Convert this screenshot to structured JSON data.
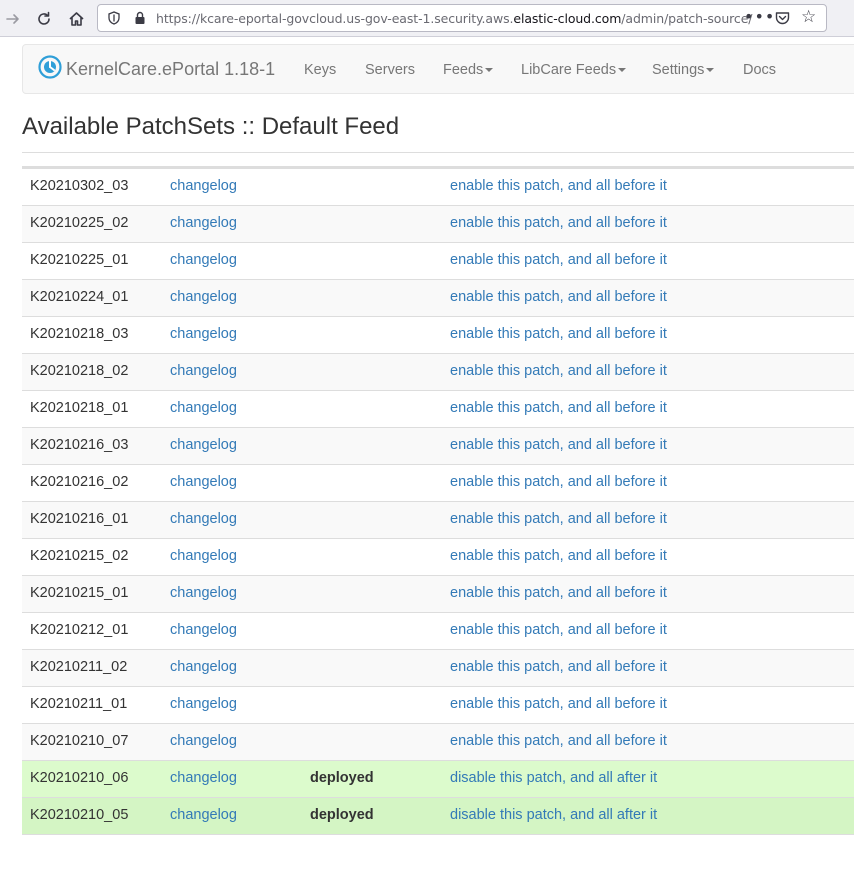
{
  "browser": {
    "url_prefix": "https://kcare-eportal-govcloud.us-gov-east-1.security.aws.",
    "url_domain": "elastic-cloud.com",
    "url_path": "/admin/patch-source/",
    "more_icon": "•••"
  },
  "navbar": {
    "brand": "KernelCare.ePortal 1.18-1",
    "links": [
      "Keys",
      "Servers",
      "Feeds",
      "LibCare Feeds",
      "Settings",
      "Docs"
    ]
  },
  "page": {
    "title": "Available PatchSets :: Default Feed"
  },
  "patches": [
    {
      "name": "K20210302_03",
      "changelog": "changelog",
      "status": "",
      "action": "enable this patch, and all before it"
    },
    {
      "name": "K20210225_02",
      "changelog": "changelog",
      "status": "",
      "action": "enable this patch, and all before it"
    },
    {
      "name": "K20210225_01",
      "changelog": "changelog",
      "status": "",
      "action": "enable this patch, and all before it"
    },
    {
      "name": "K20210224_01",
      "changelog": "changelog",
      "status": "",
      "action": "enable this patch, and all before it"
    },
    {
      "name": "K20210218_03",
      "changelog": "changelog",
      "status": "",
      "action": "enable this patch, and all before it"
    },
    {
      "name": "K20210218_02",
      "changelog": "changelog",
      "status": "",
      "action": "enable this patch, and all before it"
    },
    {
      "name": "K20210218_01",
      "changelog": "changelog",
      "status": "",
      "action": "enable this patch, and all before it"
    },
    {
      "name": "K20210216_03",
      "changelog": "changelog",
      "status": "",
      "action": "enable this patch, and all before it"
    },
    {
      "name": "K20210216_02",
      "changelog": "changelog",
      "status": "",
      "action": "enable this patch, and all before it"
    },
    {
      "name": "K20210216_01",
      "changelog": "changelog",
      "status": "",
      "action": "enable this patch, and all before it"
    },
    {
      "name": "K20210215_02",
      "changelog": "changelog",
      "status": "",
      "action": "enable this patch, and all before it"
    },
    {
      "name": "K20210215_01",
      "changelog": "changelog",
      "status": "",
      "action": "enable this patch, and all before it"
    },
    {
      "name": "K20210212_01",
      "changelog": "changelog",
      "status": "",
      "action": "enable this patch, and all before it"
    },
    {
      "name": "K20210211_02",
      "changelog": "changelog",
      "status": "",
      "action": "enable this patch, and all before it"
    },
    {
      "name": "K20210211_01",
      "changelog": "changelog",
      "status": "",
      "action": "enable this patch, and all before it"
    },
    {
      "name": "K20210210_07",
      "changelog": "changelog",
      "status": "",
      "action": "enable this patch, and all before it"
    },
    {
      "name": "K20210210_06",
      "changelog": "changelog",
      "status": "deployed",
      "action": "disable this patch, and all after it"
    },
    {
      "name": "K20210210_05",
      "changelog": "changelog",
      "status": "deployed",
      "action": "disable this patch, and all after it"
    },
    {
      "name": "",
      "changelog": "",
      "status": "",
      "action": ""
    }
  ]
}
